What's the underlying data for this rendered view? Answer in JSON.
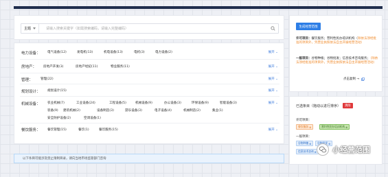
{
  "search": {
    "scope_label": "主题",
    "placeholder": "请输入搜索关键字（如需搜索编码，请输入完整编码）"
  },
  "categories": [
    {
      "title": "电力设备：",
      "items": [
        "电气设备(12)",
        "发电机(13)",
        "机电设备(13)",
        "电机(3)",
        "电力设备(2)"
      ],
      "expand": "展开"
    },
    {
      "title": "房地产：",
      "items": [
        "房地产开发(3)",
        "房地产经纪(11)",
        "物业服务(11)"
      ],
      "expand": "展开"
    },
    {
      "title": "管理：",
      "items": [
        "管理(22)"
      ],
      "expand": "展开"
    },
    {
      "title": "规划设计：",
      "items": [
        "规划设计(15)"
      ],
      "expand": "展开"
    },
    {
      "title": "机械设备：",
      "items": [
        "农业机械(7)",
        "工业设备(24)",
        "工程设备(5)",
        "机械设备(9)",
        "办公设备(3)",
        "环保设备(9)",
        "智能设备(3)",
        "装备(9)",
        "建筑机械(2)",
        "设备制造(3)",
        "游乐设备(3)",
        "电子设备(4)",
        "机械制造(2)",
        "集业(1)",
        "安全防护设备(2)",
        "空调设备(1)"
      ],
      "expand": "展开"
    },
    {
      "title": "餐饮服务：",
      "items": [
        "餐饮管理(15)",
        "餐饮(1)",
        "餐饮服务(15)"
      ],
      "expand": "展开"
    }
  ],
  "notice": "以下条目可能涉及禁止限制目录，请向当地市场监管部门咨询",
  "right_panel": {
    "generate_button": "生成经营范围",
    "licensed_label": "许可项目：",
    "licensed_text": "餐饮服务；营利性民办培训机构（",
    "licensed_text_orange": "除依法须经批准的项目外，凭营业执照依法自主开展经营活动）",
    "general_label": "一般项目：",
    "general_text": "谷物种植；谷物批发；信息技术咨询服务；",
    "general_text_orange": "（除依法须经批准的项目外，凭营业执照依法自主开展经营活动）",
    "copy_label": "点击复制 →"
  },
  "selected_panel": {
    "header": "已选条目（拖动以进行排序）",
    "clear_button": "清除",
    "licensed_label": "许可项目：",
    "licensed_tags": [
      "餐饮服务",
      "营利性民办培训机构"
    ],
    "general_label": "一般项目：",
    "general_tags": [
      "谷物种植",
      "谷物批发",
      "信息技术咨询"
    ]
  },
  "watermark": "小经营范围",
  "colors": {
    "accent": "#2d7ee6",
    "link": "#3d7bdc",
    "orange": "#f08c2e",
    "danger": "#e0393b",
    "topbar": "#1f2d4d"
  }
}
